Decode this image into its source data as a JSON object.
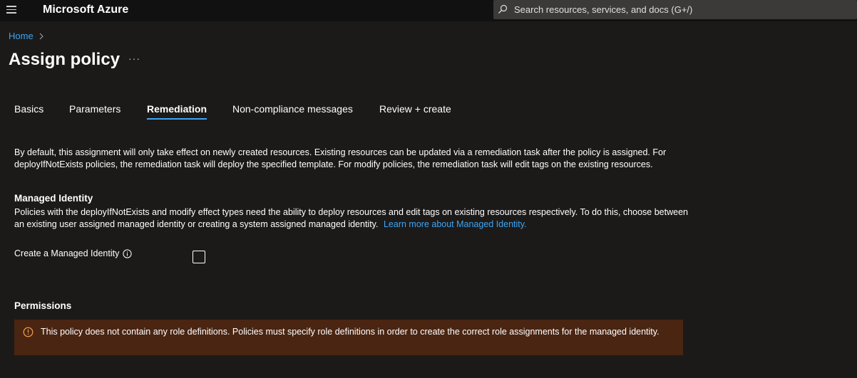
{
  "topbar": {
    "brand": "Microsoft Azure",
    "search_placeholder": "Search resources, services, and docs (G+/)"
  },
  "breadcrumb": {
    "home": "Home"
  },
  "page": {
    "title": "Assign policy",
    "more": "···"
  },
  "tabs": [
    {
      "label": "Basics"
    },
    {
      "label": "Parameters"
    },
    {
      "label": "Remediation",
      "active": true
    },
    {
      "label": "Non-compliance messages"
    },
    {
      "label": "Review + create"
    }
  ],
  "remediation": {
    "description": "By default, this assignment will only take effect on newly created resources. Existing resources can be updated via a remediation task after the policy is assigned. For deployIfNotExists policies, the remediation task will deploy the specified template. For modify policies, the remediation task will edit tags on the existing resources."
  },
  "managed_identity": {
    "title": "Managed Identity",
    "description": "Policies with the deployIfNotExists and modify effect types need the ability to deploy resources and edit tags on existing resources respectively. To do this, choose between an existing user assigned managed identity or creating a system assigned managed identity.",
    "learn_more": "Learn more about Managed Identity.",
    "create_label": "Create a Managed Identity",
    "create_checked": false
  },
  "permissions": {
    "title": "Permissions",
    "warning": "This policy does not contain any role definitions. Policies must specify role definitions in order to create the correct role assignments for the managed identity."
  },
  "colors": {
    "accent": "#3da5f4",
    "background": "#1b1a19",
    "warning_bg": "#4a2512",
    "warning_icon": "#f7a24f"
  }
}
